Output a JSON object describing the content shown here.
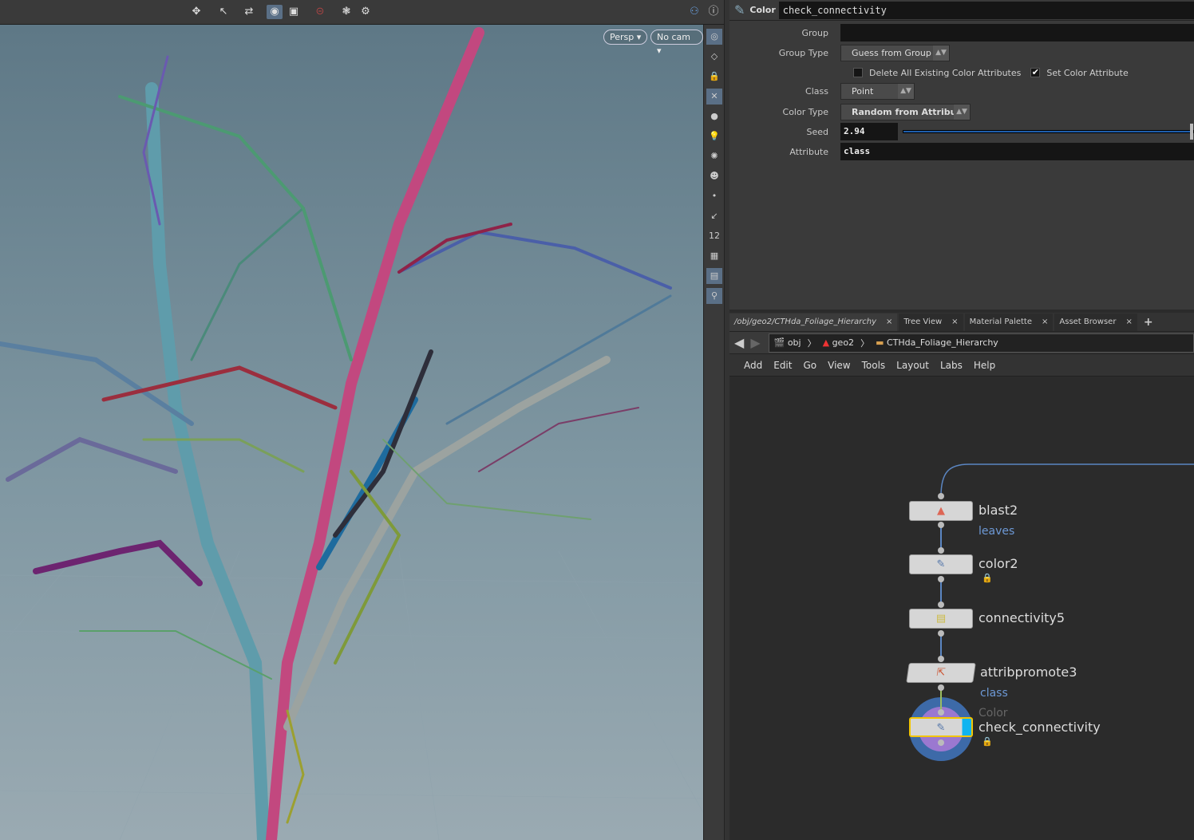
{
  "viewport": {
    "camera_view": "Persp",
    "camera": "No cam"
  },
  "params": {
    "node_type": "Color",
    "node_name": "check_connectivity",
    "fields": {
      "group_label": "Group",
      "group_value": "",
      "group_type_label": "Group Type",
      "group_type_value": "Guess from Group",
      "delete_existing_label": "Delete All Existing Color Attributes",
      "delete_existing_checked": false,
      "set_color_label": "Set Color Attribute",
      "set_color_checked": true,
      "class_label": "Class",
      "class_value": "Point",
      "color_type_label": "Color Type",
      "color_type_value": "Random from Attribute",
      "seed_label": "Seed",
      "seed_value": "2.94",
      "attribute_label": "Attribute",
      "attribute_value": "class"
    }
  },
  "network": {
    "tabs": [
      {
        "label": "/obj/geo2/CTHda_Foliage_Hierarchy"
      },
      {
        "label": "Tree View"
      },
      {
        "label": "Material Palette"
      },
      {
        "label": "Asset Browser"
      }
    ],
    "add_tab": "+",
    "breadcrumbs": [
      "obj",
      "geo2",
      "CTHda_Foliage_Hierarchy"
    ],
    "menu": [
      "Add",
      "Edit",
      "Go",
      "View",
      "Tools",
      "Layout",
      "Labs",
      "Help"
    ],
    "nodes": [
      {
        "name": "blast2",
        "comment": "leaves"
      },
      {
        "name": "color2",
        "locked": true
      },
      {
        "name": "connectivity5"
      },
      {
        "name": "attribpromote3",
        "comment": "class"
      },
      {
        "name": "check_connectivity",
        "type_label": "Color",
        "locked": true,
        "selected": true,
        "display": true
      }
    ]
  },
  "colors": {
    "accent": "#1f5fae",
    "selected_outline": "#f2c500",
    "display_flag": "#0fb4f0"
  }
}
